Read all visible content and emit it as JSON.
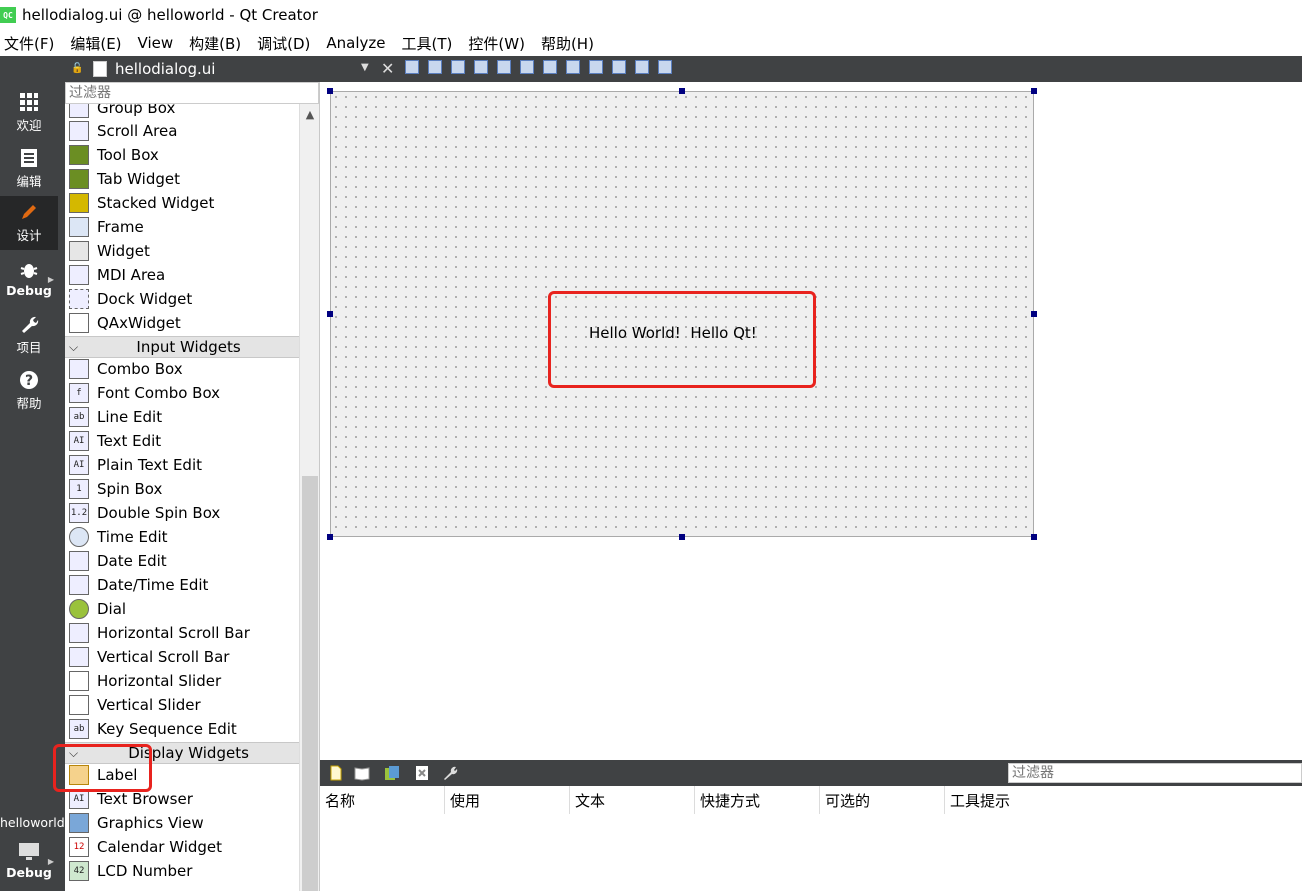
{
  "window": {
    "title": "hellodialog.ui @ helloworld - Qt Creator",
    "app_icon": "QC"
  },
  "menu": [
    "文件(F)",
    "编辑(E)",
    "View",
    "构建(B)",
    "调试(D)",
    "Analyze",
    "工具(T)",
    "控件(W)",
    "帮助(H)"
  ],
  "modes": [
    {
      "label": "欢迎",
      "icon": "grid-icon"
    },
    {
      "label": "编辑",
      "icon": "document-icon"
    },
    {
      "label": "设计",
      "icon": "pencil-icon",
      "active": true
    },
    {
      "label": "Debug",
      "icon": "bug-icon"
    },
    {
      "label": "项目",
      "icon": "wrench-icon"
    },
    {
      "label": "帮助",
      "icon": "help-icon"
    }
  ],
  "project": {
    "name": "helloworld",
    "kit_label": "Debug"
  },
  "editor": {
    "file_name": "hellodialog.ui"
  },
  "widget_filter": {
    "placeholder": "过滤器"
  },
  "widget_box": {
    "containers": [
      "Group Box",
      "Scroll Area",
      "Tool Box",
      "Tab Widget",
      "Stacked Widget",
      "Frame",
      "Widget",
      "MDI Area",
      "Dock Widget",
      "QAxWidget"
    ],
    "input_category": "Input Widgets",
    "inputs": [
      "Combo Box",
      "Font Combo Box",
      "Line Edit",
      "Text Edit",
      "Plain Text Edit",
      "Spin Box",
      "Double Spin Box",
      "Time Edit",
      "Date Edit",
      "Date/Time Edit",
      "Dial",
      "Horizontal Scroll Bar",
      "Vertical Scroll Bar",
      "Horizontal Slider",
      "Vertical Slider",
      "Key Sequence Edit"
    ],
    "display_category": "Display Widgets",
    "displays": [
      "Label",
      "Text Browser",
      "Graphics View",
      "Calendar Widget",
      "LCD Number"
    ]
  },
  "form": {
    "label_text": "Hello World!  Hello Qt!"
  },
  "action_editor": {
    "filter_placeholder": "过滤器",
    "columns": [
      "名称",
      "使用",
      "文本",
      "快捷方式",
      "可选的",
      "工具提示"
    ]
  },
  "colors": {
    "sidebar": "#404244",
    "active_mode": "#262728",
    "highlight": "#e8231e",
    "handle": "#000080"
  }
}
